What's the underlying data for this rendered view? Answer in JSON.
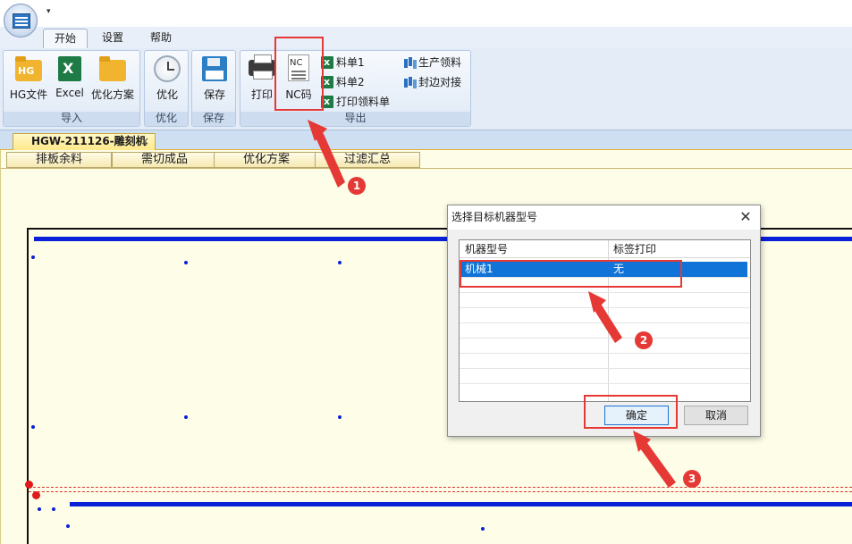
{
  "ribbon": {
    "tabs": [
      {
        "label": "开始",
        "active": true
      },
      {
        "label": "设置",
        "active": false
      },
      {
        "label": "帮助",
        "active": false
      }
    ],
    "groups": {
      "import": {
        "label": "导入",
        "buttons": {
          "hg": "HG文件",
          "hg_icon_text": "HG",
          "excel": "Excel",
          "plan": "优化方案"
        }
      },
      "optimize": {
        "label": "优化",
        "button": "优化"
      },
      "save": {
        "label": "保存",
        "button": "保存"
      },
      "export": {
        "label": "导出",
        "print": "打印",
        "nc": "NC码",
        "nc_icon_text": "NC",
        "bom1": "料单1",
        "bom2": "料单2",
        "print_material": "打印领料单",
        "production_material": "生产领料",
        "edge_banding": "封边对接"
      }
    }
  },
  "document": {
    "tab_title": "HGW-211126-雕刻机",
    "close": "×",
    "subtabs": [
      "排板余料",
      "需切成品",
      "优化方案",
      "过滤汇总"
    ]
  },
  "dialog": {
    "title": "选择目标机器型号",
    "columns": [
      "机器型号",
      "标签打印"
    ],
    "rows": [
      {
        "machine": "机械1",
        "label_print": "无",
        "selected": true
      }
    ],
    "ok": "确定",
    "cancel": "取消"
  },
  "annotations": [
    "1",
    "2",
    "3"
  ],
  "colors": {
    "highlight": "#e53935",
    "selection": "#0f73d8",
    "board_line": "#0a1fd8",
    "workspace_bg": "#fdfde8"
  }
}
